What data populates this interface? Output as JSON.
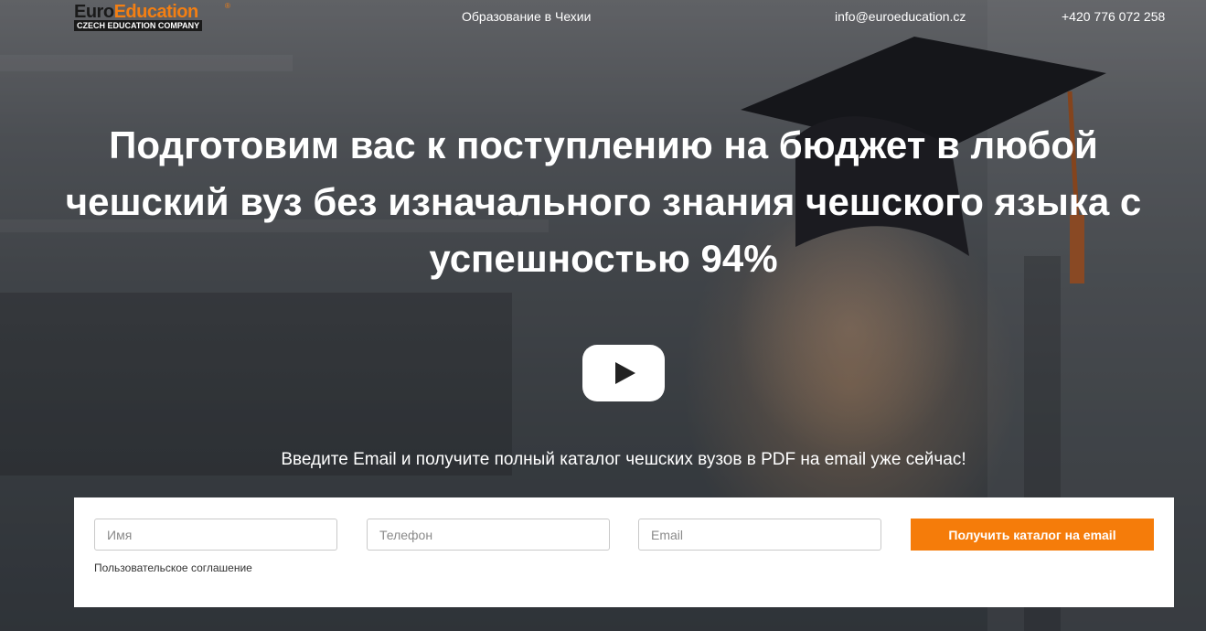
{
  "header": {
    "logo": {
      "euro": "Euro",
      "education": "Education",
      "registered": "®",
      "subtitle": "CZECH EDUCATION COMPANY"
    },
    "nav_education": "Образование в Чехии",
    "email": "info@euroeducation.cz",
    "phone": "+420 776 072 258"
  },
  "hero": {
    "headline": "Подготовим вас к поступлению на бюджет в любой чешский вуз без изначального знания чешского языка с успешностью 94%",
    "promo": "Введите Email и получите полный каталог чешских вузов в PDF на email уже сейчас!"
  },
  "form": {
    "name_placeholder": "Имя",
    "phone_placeholder": "Телефон",
    "email_placeholder": "Email",
    "submit_label": "Получить каталог на email",
    "agreement_label": "Пользовательское соглашение"
  },
  "colors": {
    "accent": "#f57c0a",
    "logo_orange": "#f37f13"
  },
  "icons": {
    "play": "play-icon"
  }
}
